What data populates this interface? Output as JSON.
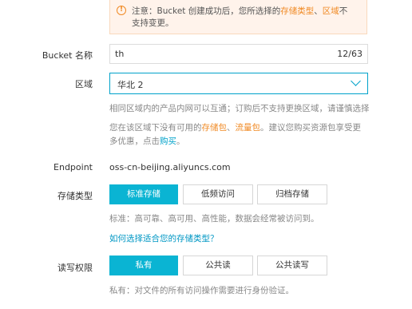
{
  "notice": {
    "prefix": "注意：Bucket 创建成功后，您所选择的",
    "storage_class": "存储类型",
    "sep": "、",
    "region": "区域",
    "suffix_line1": "不",
    "line2": "支持变更。"
  },
  "bucket_name": {
    "label": "Bucket 名称",
    "value": "th",
    "counter": "12/63"
  },
  "region": {
    "label": "区域",
    "selected": "华北 2",
    "help_line1": "相同区域内的产品内网可以互通；订购后不支持更换区域，请谨慎选择",
    "help_line2_a": "您在该区域下没有可用的",
    "help_line2_pkg1": "存储包",
    "help_line2_sep": "、",
    "help_line2_pkg2": "流量包",
    "help_line2_b": "。建议您购买资源包享受更",
    "help_line3_a": "多优惠，点击",
    "help_line3_link": "购买",
    "help_line3_b": "。"
  },
  "endpoint": {
    "label": "Endpoint",
    "value": "oss-cn-beijing.aliyuncs.com"
  },
  "storage_class": {
    "label": "存储类型",
    "options": [
      "标准存储",
      "低频访问",
      "归档存储"
    ],
    "selected_index": 0,
    "description": "标准：高可靠、高可用、高性能，数据会经常被访问到。",
    "help_link": "如何选择适合您的存储类型？"
  },
  "acl": {
    "label": "读写权限",
    "options": [
      "私有",
      "公共读",
      "公共读写"
    ],
    "selected_index": 0,
    "description": "私有：对文件的所有访问操作需要进行身份验证。"
  },
  "colors": {
    "accent": "#0ab4d3",
    "warning": "#f08a24",
    "notice_bg": "#fff3eb"
  }
}
